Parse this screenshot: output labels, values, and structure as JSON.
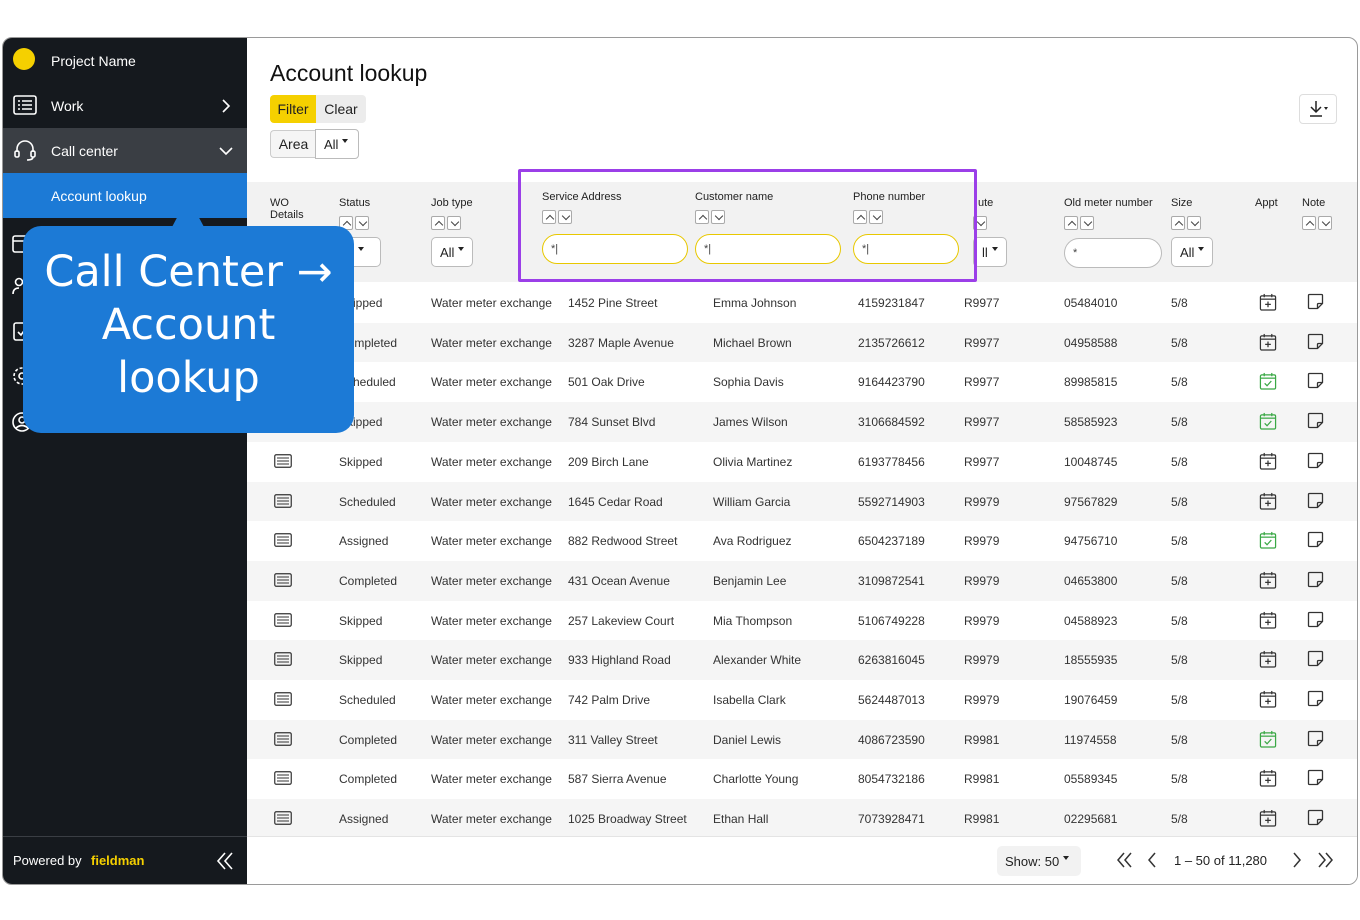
{
  "sidebar": {
    "project": "Project Name",
    "work": "Work",
    "call_center": "Call center",
    "account_lookup": "Account lookup",
    "powered_by": "Powered by",
    "brand": "fieldman",
    "brand_color": "#f5d000",
    "icons": [
      "calendar-icon",
      "users-icon",
      "checklist-icon",
      "settings-icon",
      "user-circle-icon"
    ]
  },
  "page": {
    "title": "Account lookup",
    "filter_label": "Filter",
    "clear_label": "Clear",
    "area_label": "Area",
    "area_value": "All"
  },
  "columns": {
    "wo": "WO Details",
    "status": "Status",
    "job_type": "Job type",
    "service_address": "Service Address",
    "customer_name": "Customer name",
    "phone": "Phone number",
    "route": "ute",
    "old_meter": "Old meter number",
    "size": "Size",
    "appt": "Appt",
    "note": "Note"
  },
  "filters": {
    "status_value": "ll",
    "job_type_value": "All",
    "address_value": "*|",
    "customer_value": "*|",
    "phone_value": "*|",
    "route_value": "ll",
    "old_meter_value": "*",
    "size_value": "All"
  },
  "rows": [
    {
      "status": "Skipped",
      "job": "Water meter exchange",
      "address": "1452 Pine Street",
      "name": "Emma Johnson",
      "phone": "4159231847",
      "route": "R9977",
      "meter": "05484010",
      "size": "5/8",
      "appt": "add"
    },
    {
      "status": "Completed",
      "job": "Water meter exchange",
      "address": "3287 Maple Avenue",
      "name": "Michael Brown",
      "phone": "2135726612",
      "route": "R9977",
      "meter": "04958588",
      "size": "5/8",
      "appt": "add"
    },
    {
      "status": "Scheduled",
      "job": "Water meter exchange",
      "address": "501 Oak Drive",
      "name": "Sophia Davis",
      "phone": "9164423790",
      "route": "R9977",
      "meter": "89985815",
      "size": "5/8",
      "appt": "done"
    },
    {
      "status": "Skipped",
      "job": "Water meter exchange",
      "address": "784 Sunset Blvd",
      "name": "James Wilson",
      "phone": "3106684592",
      "route": "R9977",
      "meter": "58585923",
      "size": "5/8",
      "appt": "done"
    },
    {
      "status": "Skipped",
      "job": "Water meter exchange",
      "address": "209 Birch Lane",
      "name": "Olivia Martinez",
      "phone": "6193778456",
      "route": "R9977",
      "meter": "10048745",
      "size": "5/8",
      "appt": "add"
    },
    {
      "status": "Scheduled",
      "job": "Water meter exchange",
      "address": "1645 Cedar Road",
      "name": "William Garcia",
      "phone": "5592714903",
      "route": "R9979",
      "meter": "97567829",
      "size": "5/8",
      "appt": "add"
    },
    {
      "status": "Assigned",
      "job": "Water meter exchange",
      "address": "882 Redwood Street",
      "name": "Ava Rodriguez",
      "phone": "6504237189",
      "route": "R9979",
      "meter": "94756710",
      "size": "5/8",
      "appt": "done"
    },
    {
      "status": "Completed",
      "job": "Water meter exchange",
      "address": "431 Ocean Avenue",
      "name": "Benjamin Lee",
      "phone": "3109872541",
      "route": "R9979",
      "meter": "04653800",
      "size": "5/8",
      "appt": "add"
    },
    {
      "status": "Skipped",
      "job": "Water meter exchange",
      "address": "257 Lakeview Court",
      "name": "Mia Thompson",
      "phone": "5106749228",
      "route": "R9979",
      "meter": "04588923",
      "size": "5/8",
      "appt": "add"
    },
    {
      "status": "Skipped",
      "job": "Water meter exchange",
      "address": "933 Highland Road",
      "name": "Alexander White",
      "phone": "6263816045",
      "route": "R9979",
      "meter": "18555935",
      "size": "5/8",
      "appt": "add"
    },
    {
      "status": "Scheduled",
      "job": "Water meter exchange",
      "address": "742 Palm Drive",
      "name": "Isabella Clark",
      "phone": "5624487013",
      "route": "R9979",
      "meter": "19076459",
      "size": "5/8",
      "appt": "add"
    },
    {
      "status": "Completed",
      "job": "Water meter exchange",
      "address": "311 Valley Street",
      "name": "Daniel Lewis",
      "phone": "4086723590",
      "route": "R9981",
      "meter": "11974558",
      "size": "5/8",
      "appt": "done"
    },
    {
      "status": "Completed",
      "job": "Water meter exchange",
      "address": "587 Sierra Avenue",
      "name": "Charlotte Young",
      "phone": "8054732186",
      "route": "R9981",
      "meter": "05589345",
      "size": "5/8",
      "appt": "add"
    },
    {
      "status": "Assigned",
      "job": "Water meter exchange",
      "address": "1025 Broadway Street",
      "name": "Ethan Hall",
      "phone": "7073928471",
      "route": "R9981",
      "meter": "02295681",
      "size": "5/8",
      "appt": "add"
    }
  ],
  "footer": {
    "show_label": "Show: 50",
    "pagination": "1 – 50 of 11,280"
  },
  "callout": {
    "line1": "Call Center →",
    "line2": "Account",
    "line3": "lookup"
  },
  "colors": {
    "accent_yellow": "#f5d000",
    "accent_blue": "#1c7ad6",
    "highlight_purple": "#9b3fe8",
    "appt_done_green": "#3aa845"
  }
}
